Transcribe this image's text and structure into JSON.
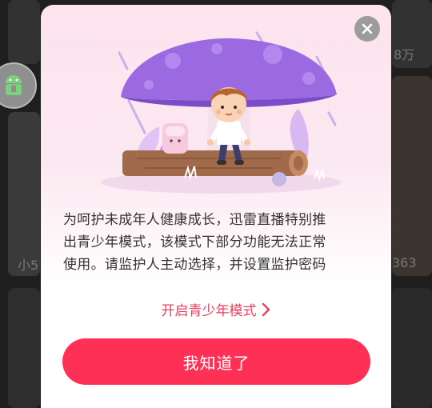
{
  "background": {
    "card_texts": [
      "8万",
      "小5",
      "363"
    ]
  },
  "dialog": {
    "close_icon": "close-icon",
    "description": "为呵护未成年人健康成长，迅雷直播特别推出青少年模式，该模式下部分功能无法正常使用。请监护人主动选择，并设置监护密码",
    "description_lines": [
      "为呵护未成年人健康成长，迅雷直播特别推",
      "出青少年模式，该模式下部分功能无法正常",
      "使用。请监护人主动选择，并设置监护密码"
    ],
    "teen_mode_link": "开启青少年模式",
    "confirm_button": "我知道了"
  },
  "colors": {
    "accent": "#ff3056",
    "link": "#e8405f",
    "mushroom": "#9b6ae0"
  }
}
